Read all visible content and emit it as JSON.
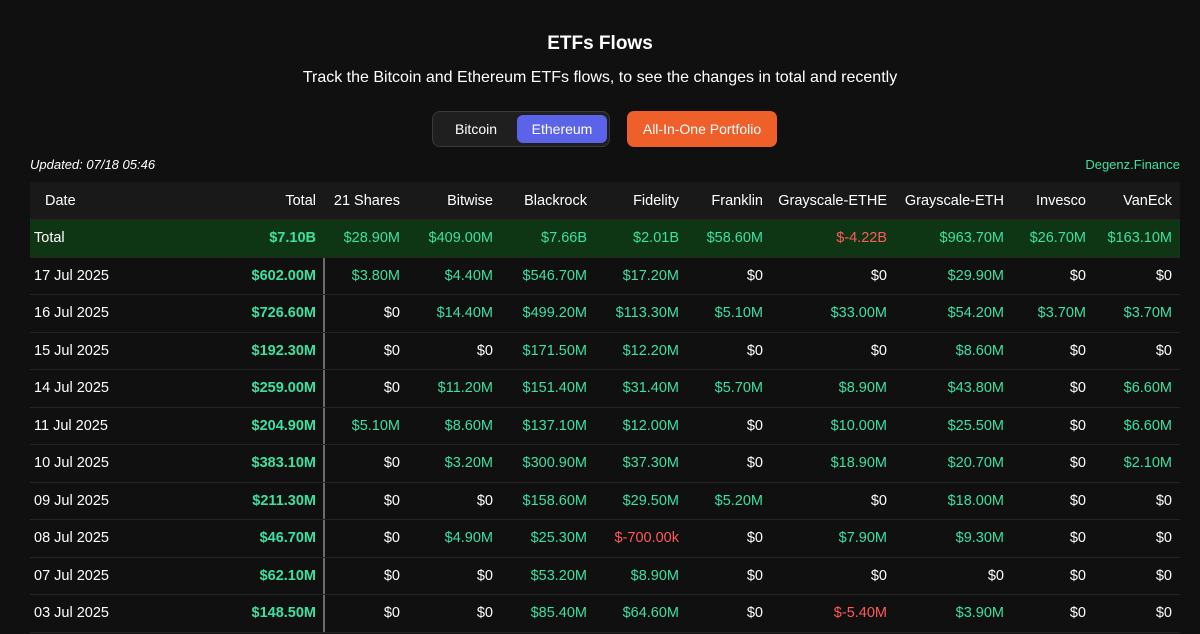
{
  "header": {
    "title": "ETFs Flows",
    "subtitle": "Track the Bitcoin and Ethereum ETFs flows, to see the changes in total and recently"
  },
  "toggle": {
    "bitcoin": "Bitcoin",
    "ethereum": "Ethereum",
    "selected": "Ethereum"
  },
  "portfolio_button": "All-In-One Portfolio",
  "updated": "Updated: 07/18 05:46",
  "brand": "Degenz.Finance",
  "colors": {
    "positive": "#3ee0a0",
    "negative": "#ff5a5a",
    "accent": "#5b63e8",
    "cta": "#ee5f2a",
    "total_row_bg": "#0e3614"
  },
  "table": {
    "columns": [
      "Date",
      "Total",
      "21 Shares",
      "Bitwise",
      "Blackrock",
      "Fidelity",
      "Franklin",
      "Grayscale-ETHE",
      "Grayscale-ETH",
      "Invesco",
      "VanEck"
    ],
    "rows": [
      [
        "Total",
        "$7.10B",
        "$28.90M",
        "$409.00M",
        "$7.66B",
        "$2.01B",
        "$58.60M",
        "$-4.22B",
        "$963.70M",
        "$26.70M",
        "$163.10M"
      ],
      [
        "17 Jul 2025",
        "$602.00M",
        "$3.80M",
        "$4.40M",
        "$546.70M",
        "$17.20M",
        "$0",
        "$0",
        "$29.90M",
        "$0",
        "$0"
      ],
      [
        "16 Jul 2025",
        "$726.60M",
        "$0",
        "$14.40M",
        "$499.20M",
        "$113.30M",
        "$5.10M",
        "$33.00M",
        "$54.20M",
        "$3.70M",
        "$3.70M"
      ],
      [
        "15 Jul 2025",
        "$192.30M",
        "$0",
        "$0",
        "$171.50M",
        "$12.20M",
        "$0",
        "$0",
        "$8.60M",
        "$0",
        "$0"
      ],
      [
        "14 Jul 2025",
        "$259.00M",
        "$0",
        "$11.20M",
        "$151.40M",
        "$31.40M",
        "$5.70M",
        "$8.90M",
        "$43.80M",
        "$0",
        "$6.60M"
      ],
      [
        "11 Jul 2025",
        "$204.90M",
        "$5.10M",
        "$8.60M",
        "$137.10M",
        "$12.00M",
        "$0",
        "$10.00M",
        "$25.50M",
        "$0",
        "$6.60M"
      ],
      [
        "10 Jul 2025",
        "$383.10M",
        "$0",
        "$3.20M",
        "$300.90M",
        "$37.30M",
        "$0",
        "$18.90M",
        "$20.70M",
        "$0",
        "$2.10M"
      ],
      [
        "09 Jul 2025",
        "$211.30M",
        "$0",
        "$0",
        "$158.60M",
        "$29.50M",
        "$5.20M",
        "$0",
        "$18.00M",
        "$0",
        "$0"
      ],
      [
        "08 Jul 2025",
        "$46.70M",
        "$0",
        "$4.90M",
        "$25.30M",
        "$-700.00k",
        "$0",
        "$7.90M",
        "$9.30M",
        "$0",
        "$0"
      ],
      [
        "07 Jul 2025",
        "$62.10M",
        "$0",
        "$0",
        "$53.20M",
        "$8.90M",
        "$0",
        "$0",
        "$0",
        "$0",
        "$0"
      ],
      [
        "03 Jul 2025",
        "$148.50M",
        "$0",
        "$0",
        "$85.40M",
        "$64.60M",
        "$0",
        "$-5.40M",
        "$3.90M",
        "$0",
        "$0"
      ]
    ]
  }
}
